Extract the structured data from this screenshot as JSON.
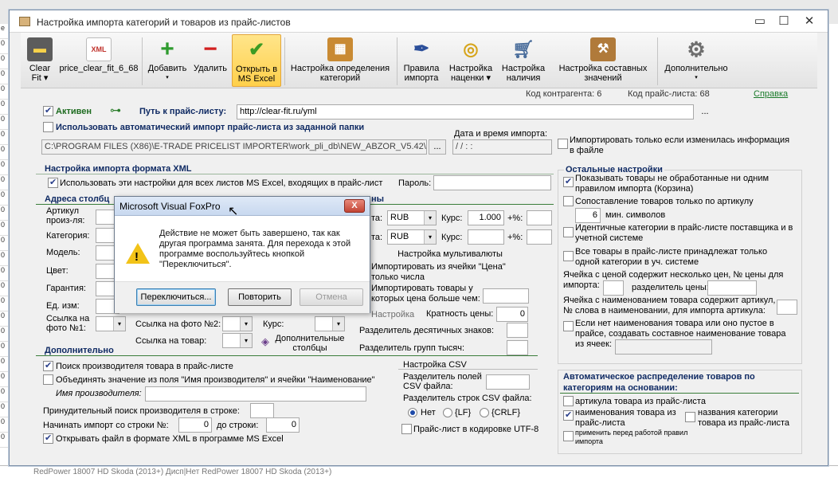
{
  "window": {
    "title": "Настройка импорта категорий и товаров из прайс-листов",
    "min": "▭",
    "max": "☐",
    "close": "✕"
  },
  "toolbar": {
    "items": [
      {
        "label1": "Clear",
        "label2": "Fit ▾",
        "icon": "truck-icon"
      },
      {
        "label1": "price_clear_fit_6_68",
        "label2": "",
        "icon": "xml-file-icon"
      },
      {
        "label1": "Добавить",
        "label2": "▾",
        "icon": "plus-icon"
      },
      {
        "label1": "Удалить",
        "label2": "",
        "icon": "minus-icon"
      },
      {
        "label1": "Открыть в",
        "label2": "MS Excel",
        "icon": "checkmark-icon"
      },
      {
        "label1": "Настройка определения",
        "label2": "категорий",
        "icon": "categories-icon"
      },
      {
        "label1": "Правила",
        "label2": "импорта",
        "icon": "feather-pen-icon"
      },
      {
        "label1": "Настройка",
        "label2": "наценки ▾",
        "icon": "coins-icon"
      },
      {
        "label1": "Настройка",
        "label2": "наличия",
        "icon": "cart-icon"
      },
      {
        "label1": "Настройка составных",
        "label2": "значений",
        "icon": "wrench-icon"
      },
      {
        "label1": "Дополнительно",
        "label2": "▾",
        "icon": "gear-icon"
      }
    ]
  },
  "info": {
    "contractor_code": "Код контрагента: 6",
    "price_code": "Код прайс-листа: 68",
    "help": "Справка"
  },
  "top": {
    "active": "Активен",
    "path_label": "Путь к прайс-листу:",
    "path_value": "http://clear-fit.ru/yml",
    "path_btn": "...",
    "auto_import": "Использовать автоматический импорт прайс-листа из заданной папки",
    "folder_value": "C:\\PROGRAM FILES (X86)\\E-TRADE PRICELIST IMPORTER\\work_pli_db\\NEW_ABZOR_V5.42\\Downl",
    "folder_btn": "...",
    "datetime_label": "Дата и время импорта:",
    "datetime_value": "/ /      : :",
    "only_changed": "Импортировать только если изменилась информация в файле"
  },
  "xml": {
    "header": "Настройка импорта формата XML",
    "all_sheets": "Использовать эти настройки для всех листов MS Excel, входящих в прайс-лист",
    "password_label": "Пароль:",
    "columns_header": "Адреса столбц",
    "prices_header_tail": "ны",
    "labels": [
      "Артикул произ-ля:",
      "Категория:",
      "Модель:",
      "Цвет:",
      "Гарантия:",
      "Ед. изм:",
      "Ссылка на фото №1:"
    ],
    "photo2": "Ссылка на фото №2:",
    "course": "Курс:",
    "link_goods": "Ссылка на товар:",
    "extra_cols": "Дополнительные столбцы",
    "currency1": "RUB",
    "currency2": "RUB",
    "rate_label": "Курс:",
    "rate_value": "1.000",
    "percent_label": "+%:",
    "multicurrency": "Настройка мультивалюты",
    "import_from_price": "Импортировать из ячейки \"Цена\" только числа",
    "import_goods_price": "Импортировать товары у которых цена больше чем:",
    "setting_short": "Настройка",
    "multiplicity_label": "Кратность цены:",
    "multiplicity_value": "0",
    "decimal_sep": "Разделитель десятичных знаков:",
    "group_sep": "Разделитель групп тысяч:",
    "ta": "та:"
  },
  "additional": {
    "header": "Дополнительно",
    "search_vendor": "Поиск производителя товара в прайс-листе",
    "merge_value": "Объединять значение из поля \"Имя производителя\" и ячейки \"Наименование\"",
    "vendor_name": "Имя производителя:",
    "forced_search": "Принудительный поиск производителя в строке:",
    "start_row": "Начинать импорт со строки №:",
    "start_value": "0",
    "to_row": "до строки:",
    "to_value": "0",
    "open_excel": "Открывать файл в формате XML в программе MS Excel"
  },
  "csv": {
    "header": "Настройка CSV",
    "field_sep": "Разделитель полей CSV файла:",
    "row_sep": "Разделитель строк CSV файла:",
    "opt_no": "Нет",
    "opt_lf": "{LF}",
    "opt_crlf": "{CRLF}",
    "utf8": "Прайс-лист в кодировке UTF-8"
  },
  "other": {
    "header": "Остальные настройки",
    "show_unprocessed": "Показывать товары не обработанные ни одним правилом импорта (Корзина)",
    "match_article": "Сопоставление товаров только по артикулу",
    "min_chars_value": "6",
    "min_chars_label": "мин. символов",
    "identical_cats": "Идентичные категории в прайс-листе поставщика и в учетной системе",
    "all_one_cat": "Все товары в прайс-листе принадлежат только одной категории в уч. системе",
    "multi_price": "Ячейка с ценой содержит несколько цен, № цены для импорта:",
    "price_sep": "разделитель цены:",
    "name_article": "Ячейка с наименованием товара содержит артикул, № слова в наименовании, для импорта артикула:",
    "compose_name": "Если нет наименования товара или оно пустое в прайсе, создавать составное наименование товара из ячеек:"
  },
  "autodist": {
    "header": "Автоматическое распределение товаров по категориям на основании:",
    "article": "артикула товара из прайс-листа",
    "goods_name": "наименования товара из прайс-листа",
    "cat_name": "названия категории товара из прайс-листа",
    "apply_before": "применить перед работой правил импорта"
  },
  "dialog": {
    "title": "Microsoft Visual FoxPro",
    "close": "X",
    "message": "Действие не может быть завершено, так как другая программа занята. Для перехода к этой программе воспользуйтесь кнопкой \"Переключиться\".",
    "btn_switch": "Переключиться...",
    "btn_retry": "Повторить",
    "btn_cancel": "Отмена"
  },
  "background": {
    "bottom_row": "RedPower 18007 HD Skoda (2013+) Дисп|Нет      RedPower 18007 HD Skoda (2013+)"
  }
}
